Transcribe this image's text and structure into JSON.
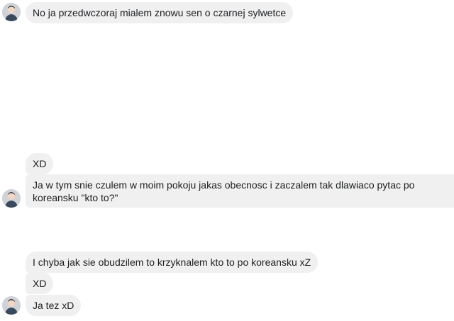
{
  "messages": [
    {
      "text": "No ja przedwczoraj mialem znowu sen o czarnej sylwetce"
    },
    {
      "text": "XD"
    },
    {
      "text": "Ja w tym snie czulem w moim pokoju jakas obecnosc i zaczalem tak dlawiaco pytac po koreansku \"kto to?\""
    },
    {
      "text": "I chyba jak sie obudzilem to krzyknalem kto to po koreansku xZ"
    },
    {
      "text": "XD"
    },
    {
      "text": "Ja tez xD"
    }
  ],
  "colors": {
    "bubble_bg": "#f0f0f0",
    "text": "#1c1e21",
    "page_bg": "#ffffff"
  }
}
